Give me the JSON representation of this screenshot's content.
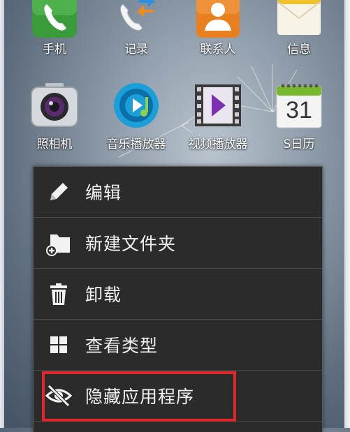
{
  "home_apps": {
    "row1": [
      {
        "label": "手机",
        "icon": "phone-icon"
      },
      {
        "label": "记录",
        "icon": "call-log-icon"
      },
      {
        "label": "联系人",
        "icon": "contacts-icon"
      },
      {
        "label": "信息",
        "icon": "messages-icon"
      }
    ],
    "row2": [
      {
        "label": "照相机",
        "icon": "camera-icon"
      },
      {
        "label": "音乐播放器",
        "icon": "music-player-icon"
      },
      {
        "label": "视频播放器",
        "icon": "video-player-icon"
      },
      {
        "label": "S日历",
        "icon": "calendar-icon",
        "day": "31"
      }
    ]
  },
  "context_menu": {
    "items": [
      {
        "label": "编辑",
        "icon": "pencil-icon"
      },
      {
        "label": "新建文件夹",
        "icon": "new-folder-icon"
      },
      {
        "label": "卸载",
        "icon": "trash-icon"
      },
      {
        "label": "查看类型",
        "icon": "grid-view-icon"
      },
      {
        "label": "隐藏应用程序",
        "icon": "hide-eye-icon"
      }
    ]
  },
  "colors": {
    "menu_bg": "#2b2b2b",
    "highlight": "#e0272b",
    "phone_green": "#3a9b3a",
    "contacts_orange": "#e9801f"
  }
}
